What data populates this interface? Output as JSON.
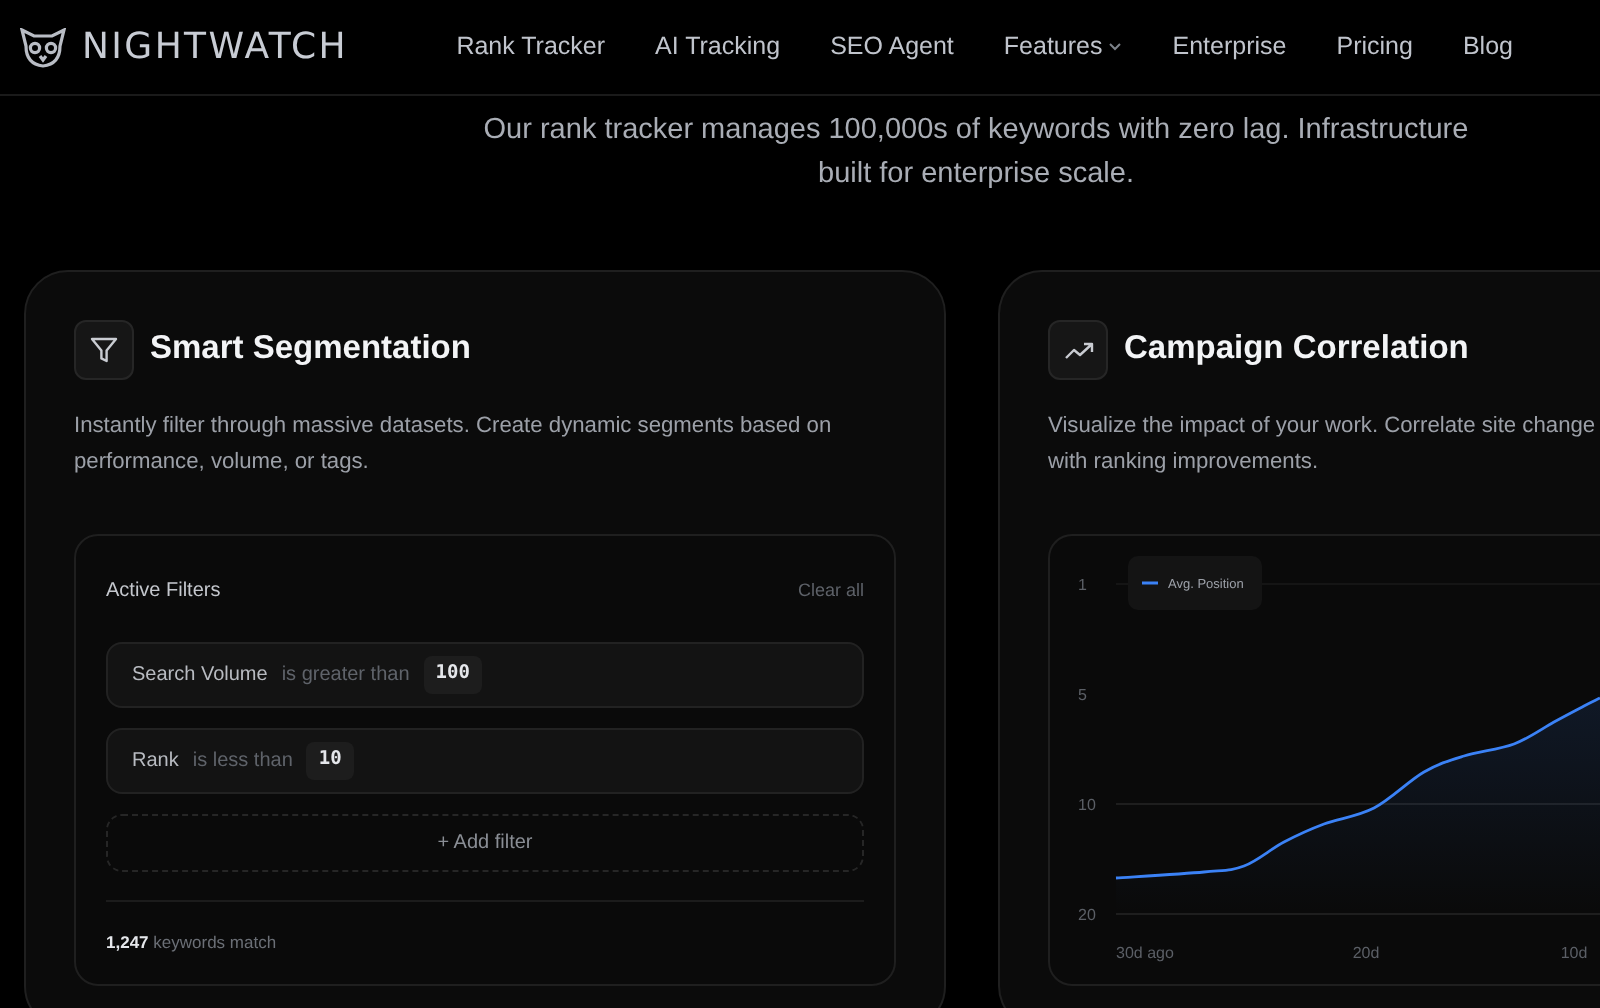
{
  "brand": {
    "name": "NIGHTWATCH"
  },
  "nav": [
    {
      "label": "Rank Tracker",
      "dropdown": false
    },
    {
      "label": "AI Tracking",
      "dropdown": false
    },
    {
      "label": "SEO Agent",
      "dropdown": false
    },
    {
      "label": "Features",
      "dropdown": true
    },
    {
      "label": "Enterprise",
      "dropdown": false
    },
    {
      "label": "Pricing",
      "dropdown": false
    },
    {
      "label": "Blog",
      "dropdown": false
    }
  ],
  "intro": "Our rank tracker manages 100,000s of keywords with zero lag. Infrastructure built for enterprise scale.",
  "cards": [
    {
      "kind": "filters",
      "title": "Smart Segmentation",
      "description": [
        "Instantly filter through massive datasets. Create dynamic segments based on",
        "performance, volume, or tags."
      ],
      "panel": {
        "heading": "Active Filters",
        "clear": "Clear all",
        "filters": [
          {
            "field": "Search Volume",
            "operator": "is greater than",
            "value": "100"
          },
          {
            "field": "Rank",
            "operator": "is less than",
            "value": "10"
          }
        ],
        "add": "+ Add filter",
        "count": "1,247",
        "count_label": "keywords match"
      }
    },
    {
      "kind": "chart",
      "title": "Campaign Correlation",
      "description": [
        "Visualize the impact of your work. Correlate site change",
        "with ranking improvements."
      ],
      "panel": {
        "legend": "Avg. Position",
        "y_labels": [
          "1",
          "5",
          "10",
          "20"
        ],
        "x_labels": [
          "30d ago",
          "20d",
          "10d"
        ]
      }
    }
  ]
}
